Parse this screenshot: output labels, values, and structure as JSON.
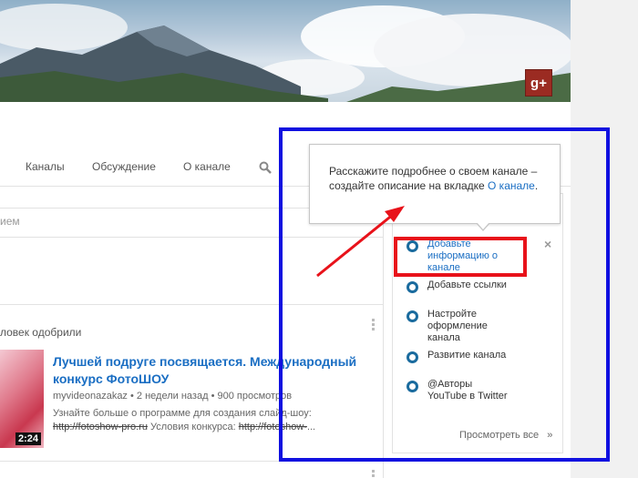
{
  "banner": {
    "gplus_label": "g+"
  },
  "tabs": [
    "Каналы",
    "Обсуждение",
    "О канале"
  ],
  "discussion": {
    "input_placeholder_fragment": "ием",
    "approved_text": "ловек одобрили"
  },
  "video": {
    "title": "Лучшей подруге посвящается. Международный конкурс ФотоШОУ",
    "duration": "2:24",
    "author": "myvideonazakaz",
    "age": "2 недели назад",
    "views": "900 просмотров",
    "separator": "•",
    "desc_line1": "Узнайте больше о программе для создания слайд-шоу:",
    "desc_link1": "http://fotoshow-pro.ru",
    "desc_mid": " Условия конкурса: ",
    "desc_link2": "http://fotoshow-",
    "desc_ellipsis": "..."
  },
  "tooltip": {
    "text": "Расскажите подробнее о своем канале – создайте описание на вкладке ",
    "link": "О канале"
  },
  "checklist": {
    "items": [
      "Добавьте информацию о канале",
      "Добавьте ссылки",
      "Настройте оформление канала",
      "Развитие канала",
      "@Авторы YouTube в Twitter"
    ],
    "close": "×",
    "see_all": "Просмотреть все",
    "see_all_arrow": "»"
  },
  "colors": {
    "annotation_blue": "#1010e0",
    "annotation_red": "#e8121a",
    "link_blue": "#1a6ec3",
    "ring_blue": "#1a6b9e"
  }
}
